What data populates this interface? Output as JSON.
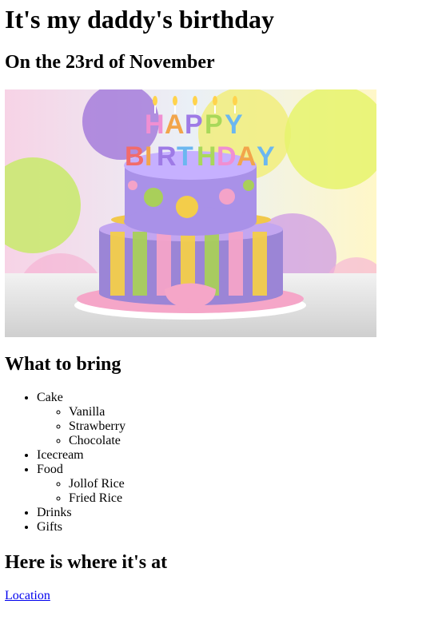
{
  "page": {
    "title": "It's my daddy's birthday",
    "date_heading": "On the 23rd of November",
    "bring_heading": "What to bring",
    "where_heading": "Here is where it's at",
    "location_link": "Location"
  },
  "image": {
    "banner_text": "HAPPY BIRTHDAY",
    "colors": {
      "cake_purple": "#9b85d6",
      "frosting_pink": "#f4a3c8",
      "stripe_green": "#a9cf5a",
      "stripe_yellow": "#f3cd4a",
      "balloon_yellow": "#f2ee7a"
    }
  },
  "bring_list": [
    {
      "label": "Cake",
      "children": [
        "Vanilla",
        "Strawberry",
        "Chocolate"
      ]
    },
    {
      "label": "Icecream",
      "children": []
    },
    {
      "label": "Food",
      "children": [
        "Jollof Rice",
        "Fried Rice"
      ]
    },
    {
      "label": "Drinks",
      "children": []
    },
    {
      "label": "Gifts",
      "children": []
    }
  ]
}
